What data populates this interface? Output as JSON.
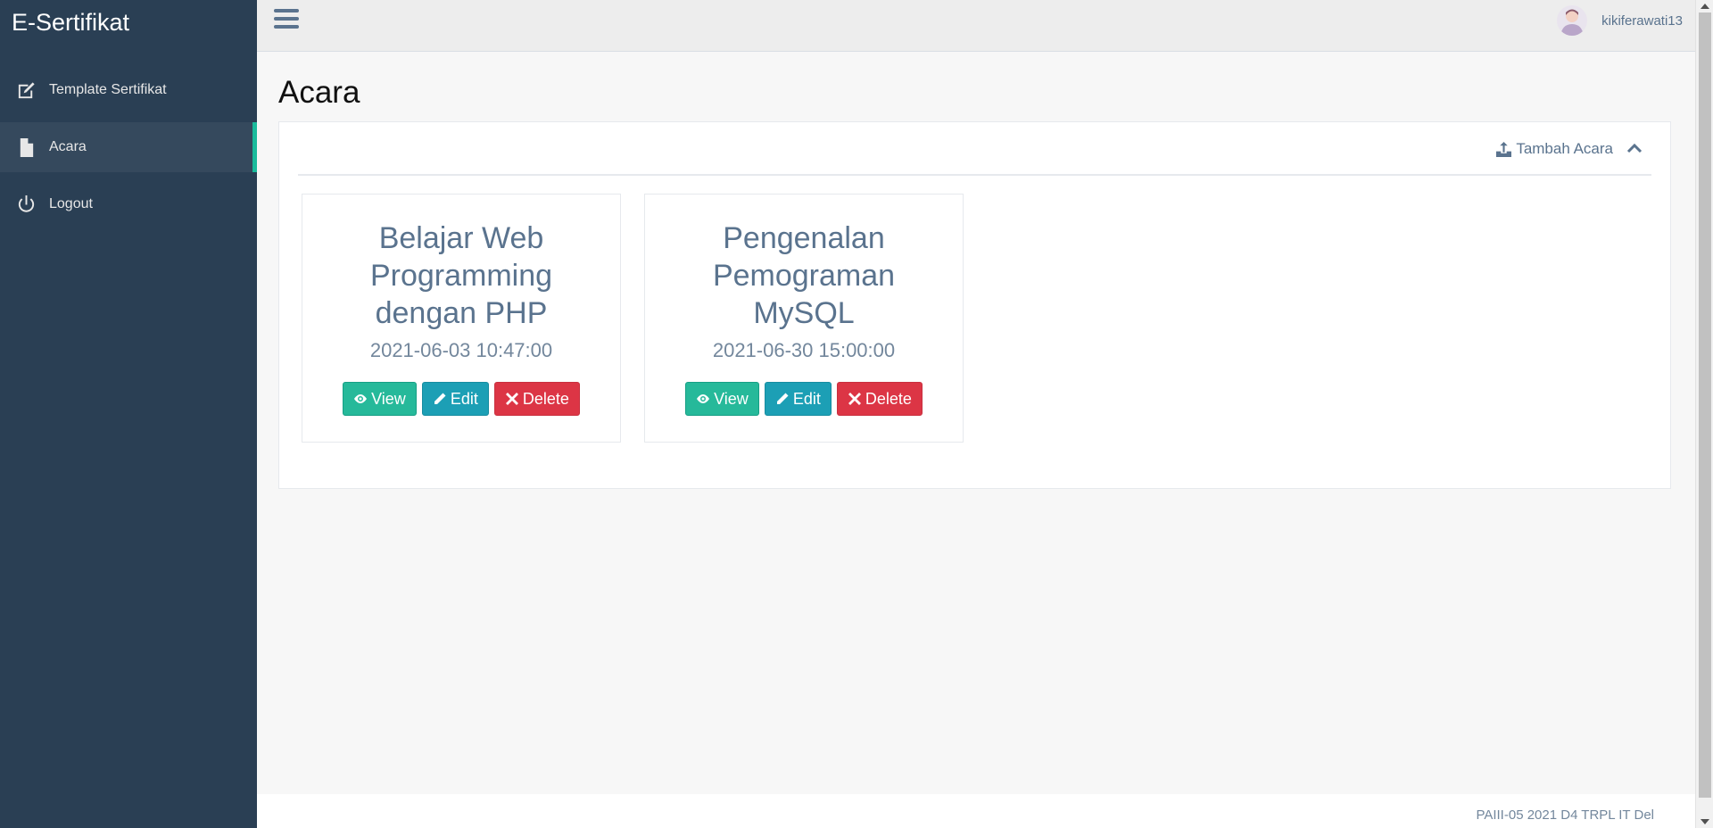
{
  "brand": "E-Sertifikat",
  "sidebar": {
    "items": [
      {
        "label": "Template Sertifikat",
        "icon": "edit-icon"
      },
      {
        "label": "Acara",
        "icon": "file-icon"
      },
      {
        "label": "Logout",
        "icon": "power-icon"
      }
    ],
    "active": "Acara"
  },
  "topbar": {
    "username": "kikiferawati13"
  },
  "page": {
    "title": "Acara",
    "add_label": "Tambah Acara"
  },
  "events": [
    {
      "title": "Belajar Web Programming dengan PHP",
      "date": "2021-06-03 10:47:00"
    },
    {
      "title": "Pengenalan Pemograman MySQL",
      "date": "2021-06-30 15:00:00"
    }
  ],
  "actions": {
    "view": "View",
    "edit": "Edit",
    "delete": "Delete"
  },
  "footer": {
    "text": "PAIII-05 2021 D4 TRPL IT Del"
  },
  "colors": {
    "sidebar": "#2a3f54",
    "accent": "#1abb9c",
    "view": "#26b99a",
    "edit": "#1c9fb5",
    "delete": "#dc3545"
  }
}
